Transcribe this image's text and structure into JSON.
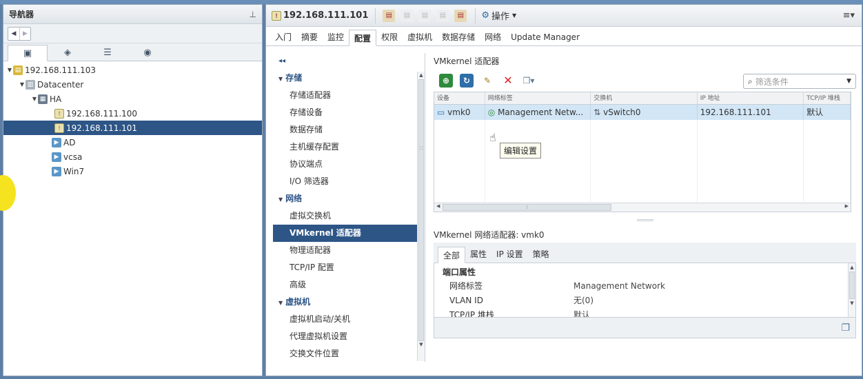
{
  "navigator": {
    "title": "导航器",
    "tree": [
      {
        "label": "192.168.111.103",
        "type": "vcenter",
        "expanded": true
      },
      {
        "label": "Datacenter",
        "type": "datacenter",
        "expanded": true
      },
      {
        "label": "HA",
        "type": "cluster",
        "expanded": true
      },
      {
        "label": "192.168.111.100",
        "type": "host-warning"
      },
      {
        "label": "192.168.111.101",
        "type": "host-warning",
        "selected": true
      },
      {
        "label": "AD",
        "type": "vm"
      },
      {
        "label": "vcsa",
        "type": "vm"
      },
      {
        "label": "Win7",
        "type": "vm"
      }
    ]
  },
  "header": {
    "host_title": "192.168.111.101",
    "actions_label": "操作"
  },
  "tabs": [
    {
      "label": "入门"
    },
    {
      "label": "摘要"
    },
    {
      "label": "监控"
    },
    {
      "label": "配置",
      "active": true
    },
    {
      "label": "权限"
    },
    {
      "label": "虚拟机"
    },
    {
      "label": "数据存储"
    },
    {
      "label": "网络"
    },
    {
      "label": "Update Manager"
    }
  ],
  "config_menu": {
    "collapse_glyph": "◂◂",
    "storage": {
      "label": "存储",
      "items": [
        "存储适配器",
        "存储设备",
        "数据存储",
        "主机缓存配置",
        "协议端点",
        "I/O 筛选器"
      ]
    },
    "network": {
      "label": "网络",
      "items": [
        "虚拟交换机",
        "VMkernel 适配器",
        "物理适配器",
        "TCP/IP 配置",
        "高级"
      ]
    },
    "vm": {
      "label": "虚拟机",
      "items": [
        "虚拟机启动/关机",
        "代理虚拟机设置",
        "交换文件位置"
      ]
    }
  },
  "vmkernel": {
    "title": "VMkernel 适配器",
    "filter_placeholder": "筛选条件",
    "tooltip": "编辑设置",
    "columns": [
      "设备",
      "网络标签",
      "交换机",
      "IP 地址",
      "TCP/IP 堆栈"
    ],
    "rows": [
      {
        "device": "vmk0",
        "network_label": "Management Netw...",
        "switch": "vSwitch0",
        "ip": "192.168.111.101",
        "tcpip": "默认"
      }
    ]
  },
  "details": {
    "title": "VMkernel 网络适配器: vmk0",
    "tabs": [
      "全部",
      "属性",
      "IP 设置",
      "策略"
    ],
    "section": "端口属性",
    "props": [
      {
        "key": "网络标签",
        "value": "Management Network"
      },
      {
        "key": "VLAN ID",
        "value": "无(0)"
      },
      {
        "key": "TCP/IP 堆栈",
        "value": "默认"
      }
    ]
  }
}
